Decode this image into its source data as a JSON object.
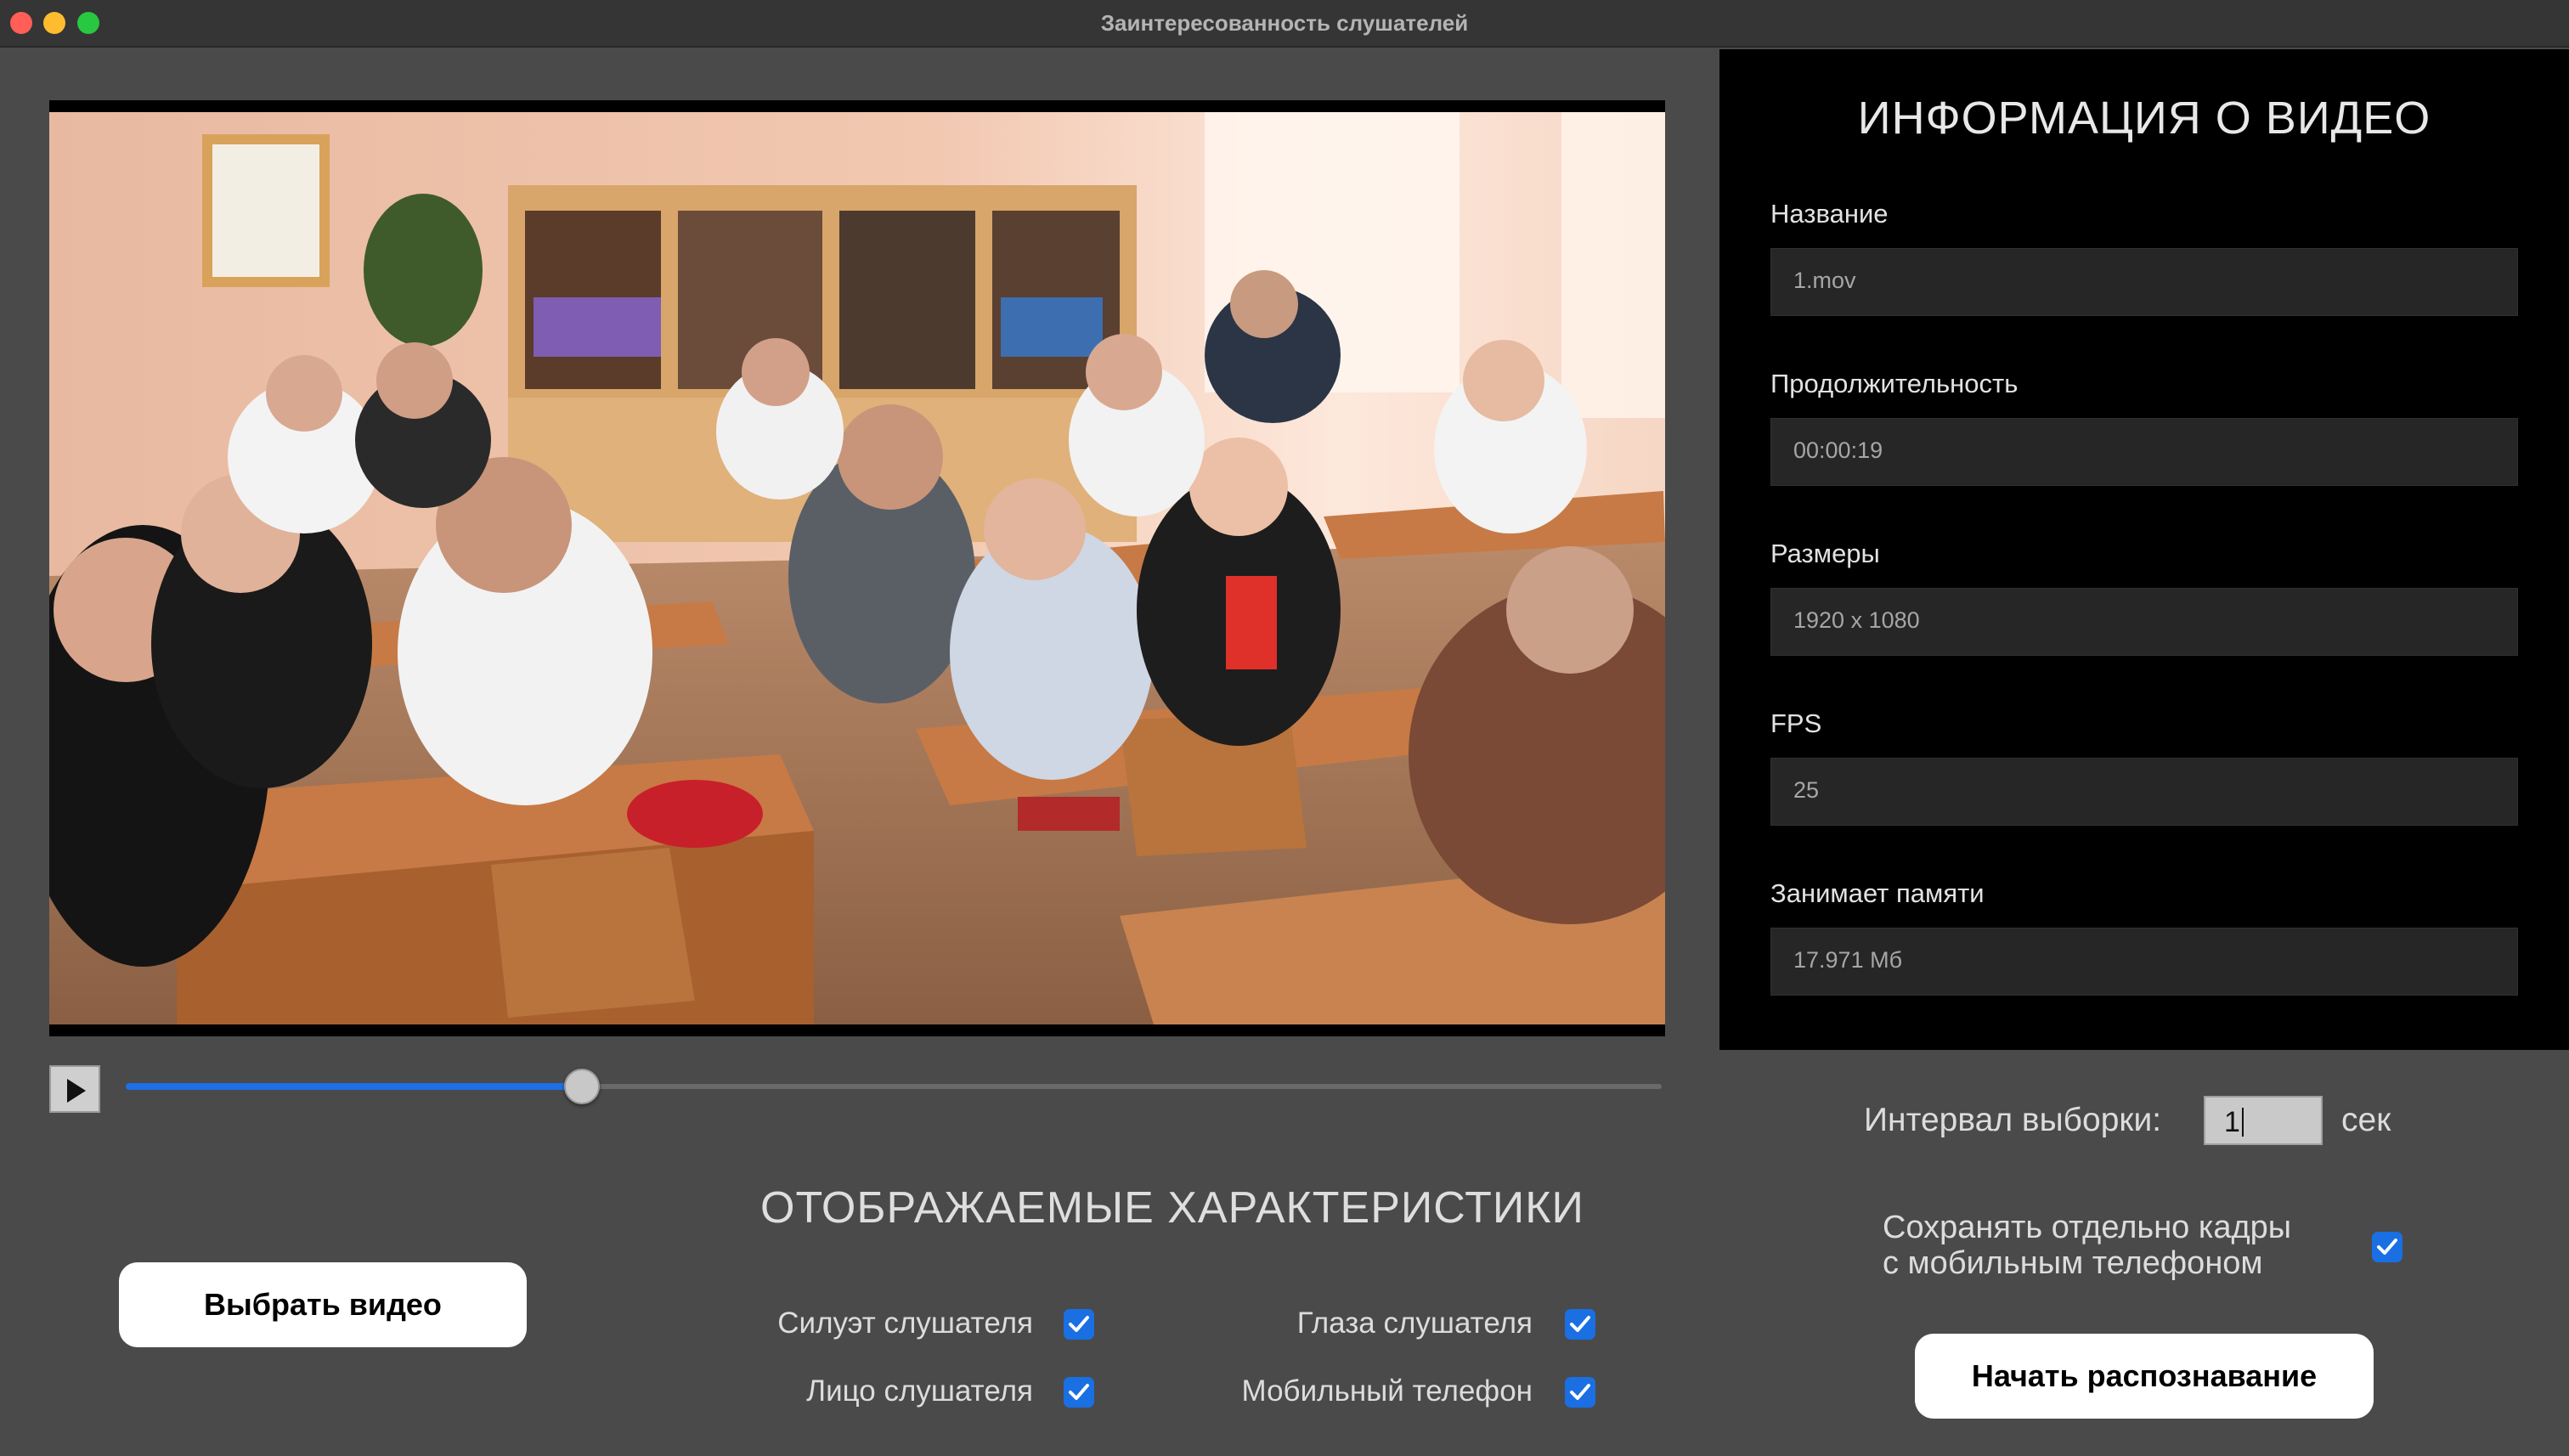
{
  "window": {
    "title": "Заинтересованность слушателей"
  },
  "player": {
    "progress": 0.297
  },
  "info": {
    "title": "ИНФОРМАЦИЯ О ВИДЕО",
    "fields": [
      {
        "label": "Название",
        "value": "1.mov"
      },
      {
        "label": "Продолжительность",
        "value": "00:00:19"
      },
      {
        "label": "Размеры",
        "value": "1920 x 1080"
      },
      {
        "label": "FPS",
        "value": "25"
      },
      {
        "label": "Занимает памяти",
        "value": "17.971 Мб"
      }
    ]
  },
  "controls": {
    "select_video": "Выбрать видео",
    "start_recognition": "Начать распознавание",
    "features_title": "ОТОБРАЖАЕМЫЕ ХАРАКТЕРИСТИКИ",
    "features": [
      {
        "label": "Силуэт слушателя",
        "checked": true
      },
      {
        "label": "Глаза слушателя",
        "checked": true
      },
      {
        "label": "Лицо слушателя",
        "checked": true
      },
      {
        "label": "Мобильный телефон",
        "checked": true
      }
    ],
    "interval": {
      "label": "Интервал выборки:",
      "value": "1",
      "unit": "сек"
    },
    "save_phone_frames": {
      "line1": "Сохранять отдельно кадры",
      "line2": "с мобильным телефоном",
      "checked": true
    }
  },
  "colors": {
    "accent": "#1a6fe3",
    "panel": "#000000",
    "background": "#4a4a4a"
  }
}
